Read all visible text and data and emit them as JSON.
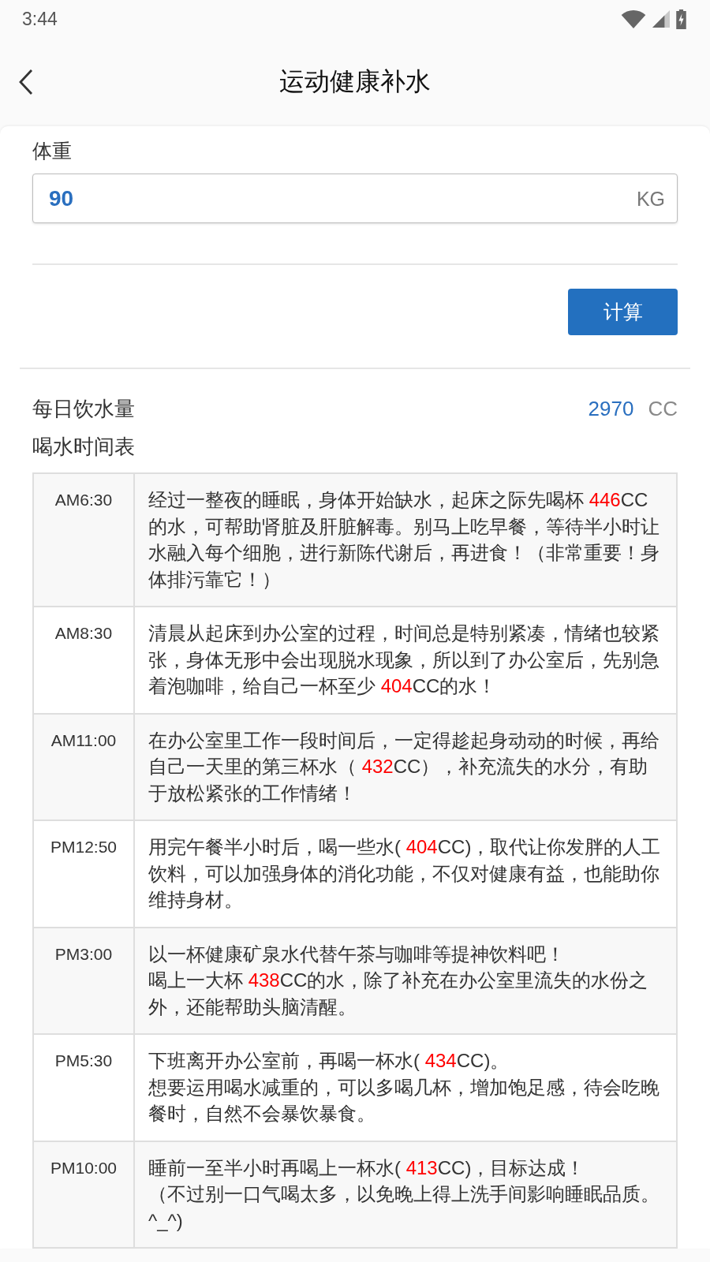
{
  "status_bar": {
    "time": "3:44"
  },
  "app_bar": {
    "title": "运动健康补水"
  },
  "weight": {
    "label": "体重",
    "value": "90",
    "unit": "KG"
  },
  "calculate_button": {
    "label": "计算"
  },
  "result": {
    "label": "每日饮水量",
    "value": "2970",
    "unit": "CC"
  },
  "schedule": {
    "title": "喝水时间表",
    "rows": [
      {
        "time": "AM6:30",
        "paragraphs": [
          {
            "parts": [
              {
                "kind": "text",
                "text": "经过一整夜的睡眠，身体开始缺水，起床之际先喝杯 "
              },
              {
                "kind": "amount",
                "text": "446"
              },
              {
                "kind": "text",
                "text": "CC的水，可帮助肾脏及肝脏解毒。别马上吃早餐，等待半小时让水融入每个细胞，进行新陈代谢后，再进食！（非常重要！身体排污靠它！）"
              }
            ]
          }
        ]
      },
      {
        "time": "AM8:30",
        "paragraphs": [
          {
            "parts": [
              {
                "kind": "text",
                "text": "清晨从起床到办公室的过程，时间总是特别紧凑，情绪也较紧张，身体无形中会出现脱水现象，所以到了办公室后，先别急着泡咖啡，给自己一杯至少 "
              },
              {
                "kind": "amount",
                "text": "404"
              },
              {
                "kind": "text",
                "text": "CC的水！"
              }
            ]
          }
        ]
      },
      {
        "time": "AM11:00",
        "paragraphs": [
          {
            "parts": [
              {
                "kind": "text",
                "text": "在办公室里工作一段时间后，一定得趁起身动动的时候，再给自己一天里的第三杯水（ "
              },
              {
                "kind": "amount",
                "text": "432"
              },
              {
                "kind": "text",
                "text": "CC），补充流失的水分，有助于放松紧张的工作情绪！"
              }
            ]
          }
        ]
      },
      {
        "time": "PM12:50",
        "paragraphs": [
          {
            "parts": [
              {
                "kind": "text",
                "text": "用完午餐半小时后，喝一些水( "
              },
              {
                "kind": "amount",
                "text": "404"
              },
              {
                "kind": "text",
                "text": "CC)，取代让你发胖的人工饮料，可以加强身体的消化功能，不仅对健康有益，也能助你维持身材。"
              }
            ]
          }
        ]
      },
      {
        "time": "PM3:00",
        "paragraphs": [
          {
            "parts": [
              {
                "kind": "text",
                "text": "以一杯健康矿泉水代替午茶与咖啡等提神饮料吧！"
              }
            ]
          },
          {
            "parts": [
              {
                "kind": "text",
                "text": "喝上一大杯 "
              },
              {
                "kind": "amount",
                "text": "438"
              },
              {
                "kind": "text",
                "text": "CC的水，除了补充在办公室里流失的水份之外，还能帮助头脑清醒。"
              }
            ]
          }
        ]
      },
      {
        "time": "PM5:30",
        "paragraphs": [
          {
            "parts": [
              {
                "kind": "text",
                "text": "下班离开办公室前，再喝一杯水( "
              },
              {
                "kind": "amount",
                "text": "434"
              },
              {
                "kind": "text",
                "text": "CC)。"
              }
            ]
          },
          {
            "parts": [
              {
                "kind": "text",
                "text": "想要运用喝水减重的，可以多喝几杯，增加饱足感，待会吃晚餐时，自然不会暴饮暴食。"
              }
            ]
          }
        ]
      },
      {
        "time": "PM10:00",
        "paragraphs": [
          {
            "parts": [
              {
                "kind": "text",
                "text": "睡前一至半小时再喝上一杯水( "
              },
              {
                "kind": "amount",
                "text": "413"
              },
              {
                "kind": "text",
                "text": "CC)，目标达成！"
              }
            ]
          },
          {
            "parts": [
              {
                "kind": "text",
                "text": "（不过别一口气喝太多，以免晚上得上洗手间影响睡眠品质。^_^)"
              }
            ]
          }
        ]
      }
    ]
  }
}
